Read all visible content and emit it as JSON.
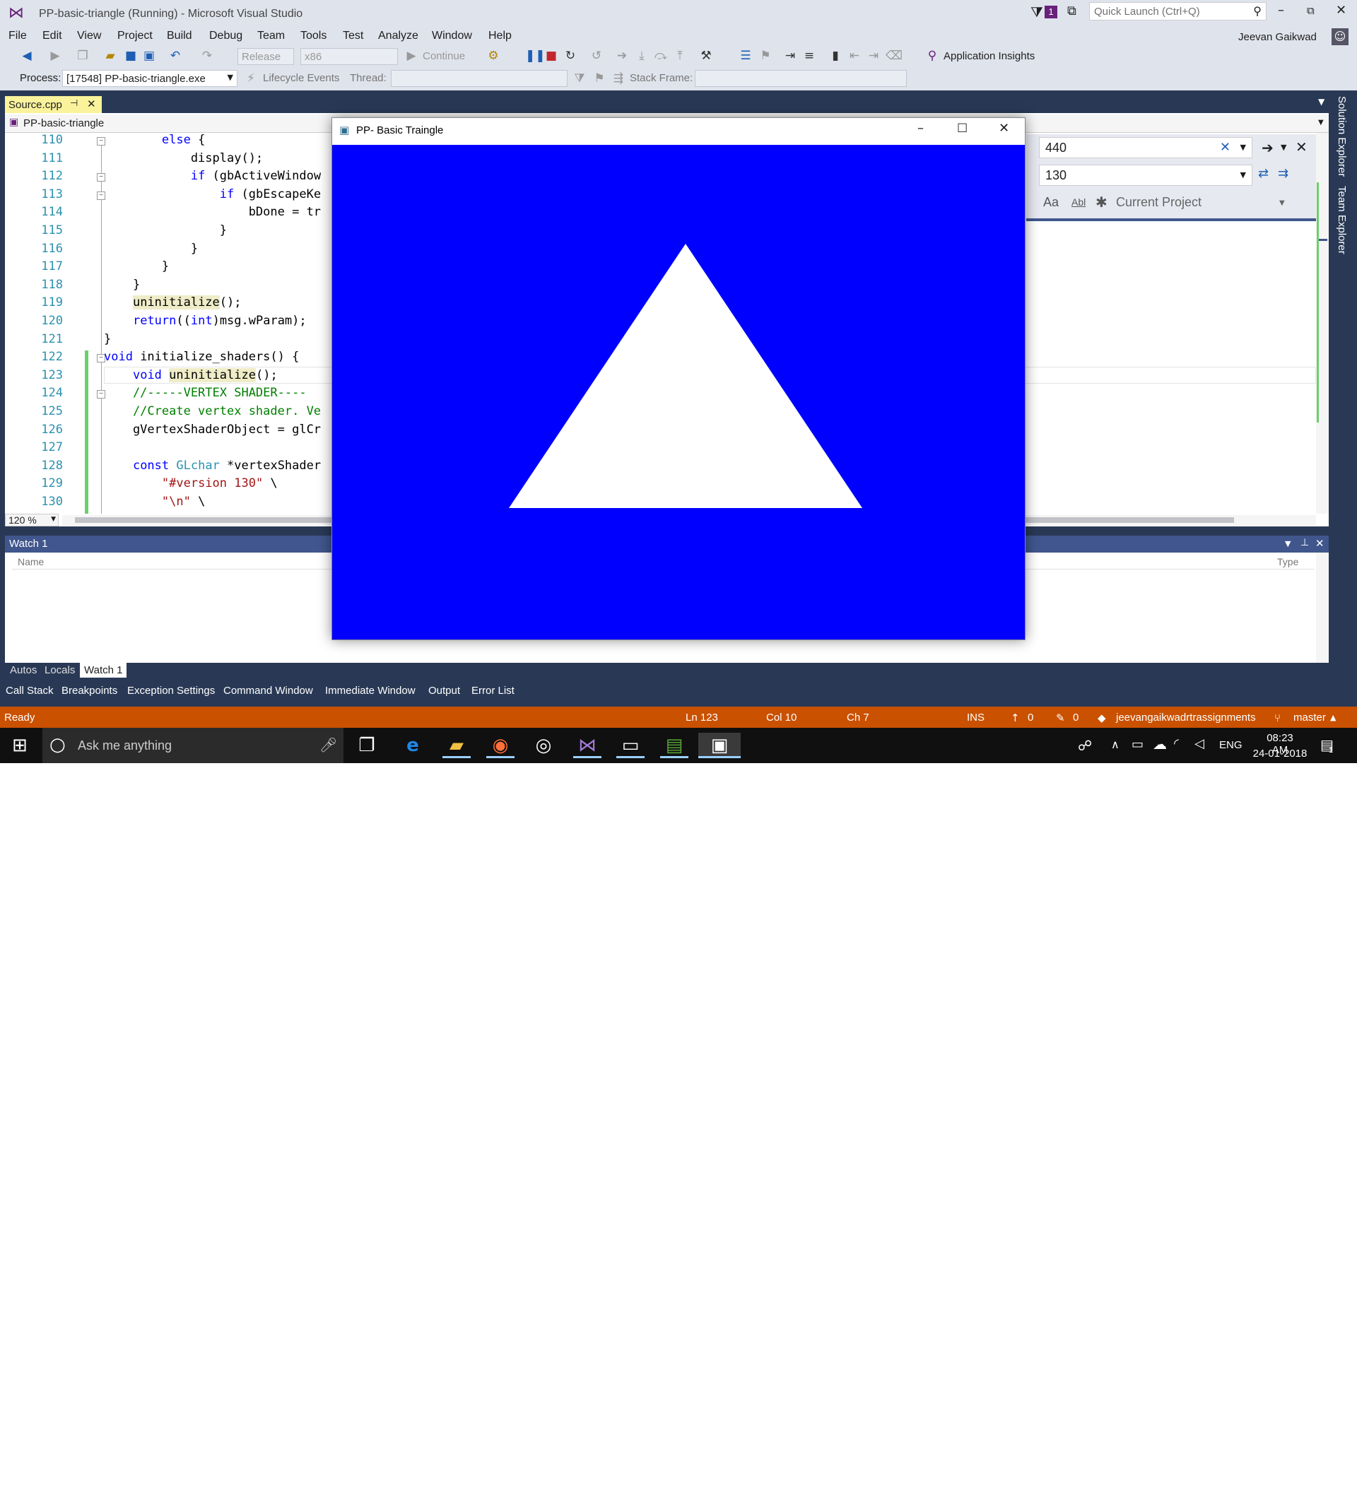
{
  "window": {
    "title": "PP-basic-triangle (Running) - Microsoft Visual Studio",
    "notification_count": "1",
    "quick_launch_placeholder": "Quick Launch (Ctrl+Q)",
    "user": "Jeevan Gaikwad"
  },
  "menu": [
    "File",
    "Edit",
    "View",
    "Project",
    "Build",
    "Debug",
    "Team",
    "Tools",
    "Test",
    "Analyze",
    "Window",
    "Help"
  ],
  "toolbar": {
    "config": "Release",
    "platform": "x86",
    "continue": "Continue",
    "insights": "Application Insights",
    "process_label": "Process:",
    "process_value": "[17548] PP-basic-triangle.exe",
    "lifecycle": "Lifecycle Events",
    "thread_label": "Thread:",
    "stack_label": "Stack Frame:"
  },
  "editor": {
    "tab": "Source.cpp",
    "project": "PP-basic-triangle",
    "zoom": "120 %",
    "lines": [
      {
        "n": "110",
        "t": "        else {"
      },
      {
        "n": "111",
        "t": "            display();"
      },
      {
        "n": "112",
        "t": "            if (gbActiveWindow"
      },
      {
        "n": "113",
        "t": "                if (gbEscapeKe"
      },
      {
        "n": "114",
        "t": "                    bDone = tr"
      },
      {
        "n": "115",
        "t": "                }"
      },
      {
        "n": "116",
        "t": "            }"
      },
      {
        "n": "117",
        "t": "        }"
      },
      {
        "n": "118",
        "t": "    }"
      },
      {
        "n": "119",
        "t": "    uninitialize();"
      },
      {
        "n": "120",
        "t": "    return((int)msg.wParam);"
      },
      {
        "n": "121",
        "t": "}"
      },
      {
        "n": "122",
        "t": "void initialize_shaders() {"
      },
      {
        "n": "123",
        "t": "    void uninitialize();"
      },
      {
        "n": "124",
        "t": "    //-----VERTEX SHADER----"
      },
      {
        "n": "125",
        "t": "    //Create vertex shader. Ve"
      },
      {
        "n": "126",
        "t": "    gVertexShaderObject = glCr"
      },
      {
        "n": "127",
        "t": ""
      },
      {
        "n": "128",
        "t": "    const GLchar *vertexShader"
      },
      {
        "n": "129",
        "t": "        \"#version 130\" \\"
      },
      {
        "n": "130",
        "t": "        \"\\n\" \\"
      }
    ]
  },
  "find": {
    "search": "440",
    "replace": "130",
    "scope": "Current Project"
  },
  "side_tabs": [
    "Solution Explorer",
    "Team Explorer"
  ],
  "watch": {
    "title": "Watch 1",
    "col_name": "Name",
    "col_type": "Type"
  },
  "bottom_tabs_row1": [
    "Autos",
    "Locals",
    "Watch 1"
  ],
  "bottom_tabs_row2": [
    "Call Stack",
    "Breakpoints",
    "Exception Settings",
    "Command Window",
    "Immediate Window",
    "Output",
    "Error List"
  ],
  "status": {
    "ready": "Ready",
    "ln": "Ln 123",
    "col": "Col 10",
    "ch": "Ch 7",
    "ins": "INS",
    "up": "0",
    "edits": "0",
    "repo": "jeevangaikwadrtrassignments",
    "branch": "master"
  },
  "taskbar": {
    "search": "Ask me anything",
    "lang": "ENG",
    "time": "08:23 AM",
    "date": "24-01-2018",
    "notif": "1"
  },
  "glwindow": {
    "title": "PP- Basic Traingle",
    "background": "#0000ff",
    "shape_color": "#ffffff"
  }
}
